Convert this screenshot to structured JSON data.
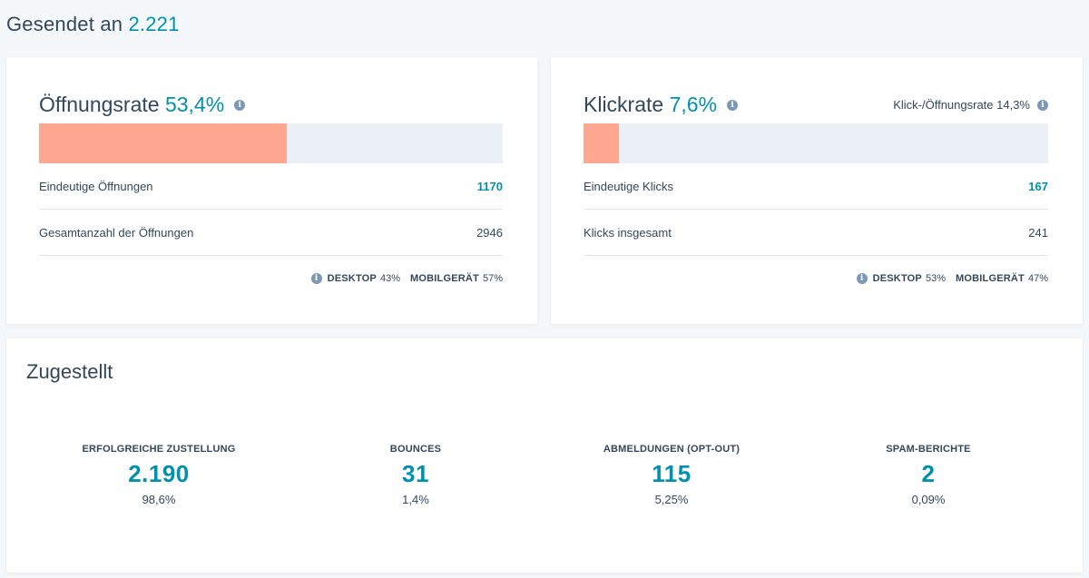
{
  "header": {
    "label": "Gesendet an",
    "value": "2.221"
  },
  "open_card": {
    "title": "Öffnungsrate",
    "rate": "53,4%",
    "bar_fraction": 0.534,
    "rows": [
      {
        "label": "Eindeutige Öffnungen",
        "value": "1170"
      },
      {
        "label": "Gesamtanzahl der Öffnungen",
        "value": "2946"
      }
    ],
    "devices": {
      "desktop_label": "DESKTOP",
      "desktop_pct": "43%",
      "mobile_label": "MOBILGERÄT",
      "mobile_pct": "57%"
    }
  },
  "click_card": {
    "title": "Klickrate",
    "rate": "7,6%",
    "ctor_text": "Klick-/Öffnungsrate 14,3%",
    "bar_fraction": 0.076,
    "rows": [
      {
        "label": "Eindeutige Klicks",
        "value": "167"
      },
      {
        "label": "Klicks insgesamt",
        "value": "241"
      }
    ],
    "devices": {
      "desktop_label": "DESKTOP",
      "desktop_pct": "53%",
      "mobile_label": "MOBILGERÄT",
      "mobile_pct": "47%"
    }
  },
  "delivered": {
    "title": "Zugestellt",
    "metrics": [
      {
        "label": "ERFOLGREICHE ZUSTELLUNG",
        "value": "2.190",
        "pct": "98,6%"
      },
      {
        "label": "BOUNCES",
        "value": "31",
        "pct": "1,4%"
      },
      {
        "label": "ABMELDUNGEN (OPT-OUT)",
        "value": "115",
        "pct": "5,25%"
      },
      {
        "label": "SPAM-BERICHTE",
        "value": "2",
        "pct": "0,09%"
      }
    ]
  },
  "colors": {
    "accent": "#0091ae",
    "bar_fill": "#ffa791",
    "bar_track": "#eaf0f6",
    "text": "#33475b",
    "info_icon": "#7c98b6"
  },
  "icons": {
    "info": "info-icon"
  }
}
